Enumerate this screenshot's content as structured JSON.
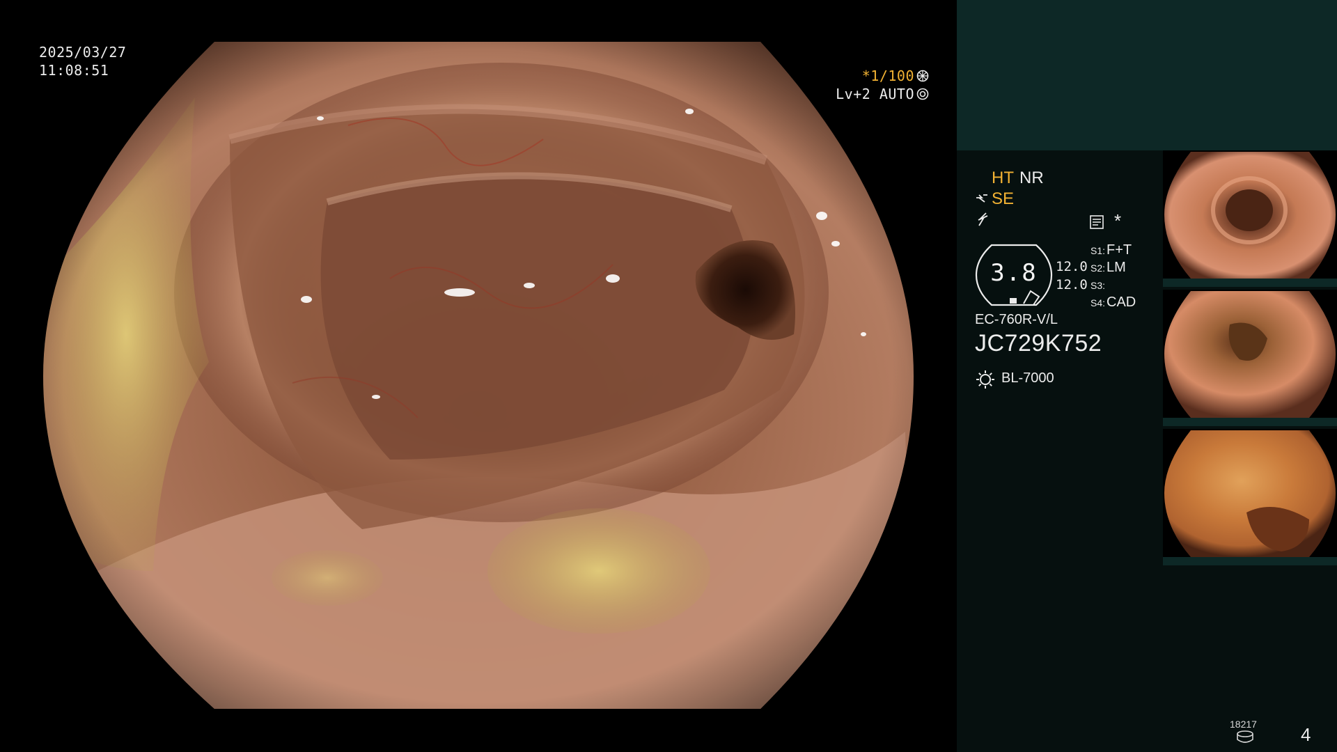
{
  "overlay": {
    "date": "2025/03/27",
    "time": "11:08:51",
    "shutter": "*1/100",
    "level": "Lv+2 AUTO"
  },
  "status": {
    "ht": "HT",
    "nr": "NR",
    "se": "SE",
    "asterisk": "*",
    "zoom": "3.8",
    "value_a": "12.0",
    "value_b": "12.0",
    "s1_key": "S1:",
    "s1_val": "F+T",
    "s2_key": "S2:",
    "s2_val": "LM",
    "s3_key": "S3:",
    "s3_val": "",
    "s4_key": "S4:",
    "s4_val": "CAD",
    "scope_model": "EC-760R-V/L",
    "scope_serial": "JC729K752",
    "light_source": "BL-7000"
  },
  "footer": {
    "image_count": "18217",
    "page_number": "4"
  },
  "colors": {
    "accent_orange": "#f2b233",
    "panel_top": "#0d2826",
    "panel_body": "#06100f"
  },
  "icons": [
    "shutter-ring-icon",
    "auto-ring-icon",
    "structure-enhance-icon",
    "freeze-icon",
    "memo-icon",
    "scope-badge-icon",
    "lamp-icon",
    "disk-icon"
  ]
}
